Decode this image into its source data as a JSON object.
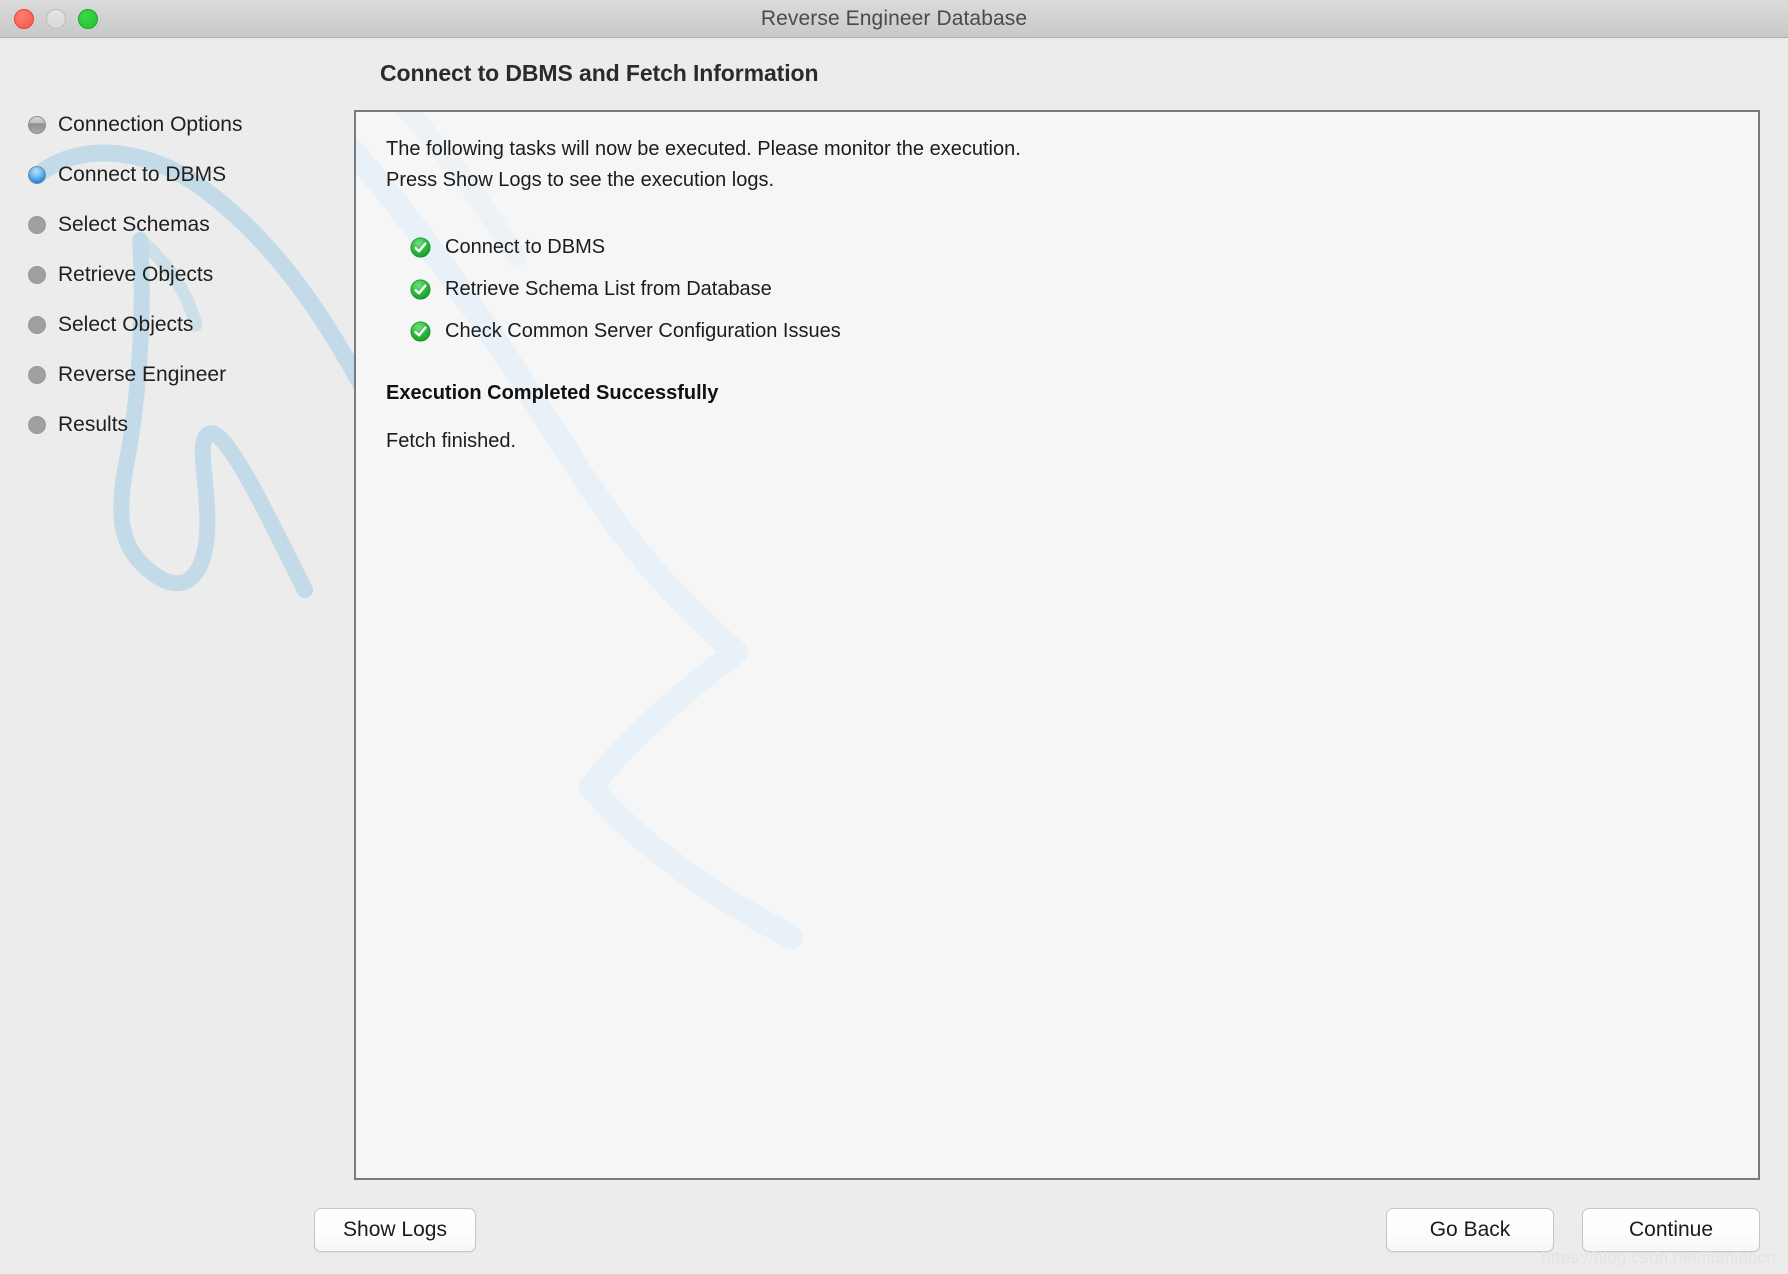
{
  "window": {
    "title": "Reverse Engineer Database",
    "traffic_lights": [
      "close",
      "minimize",
      "maximize"
    ]
  },
  "page": {
    "heading": "Connect to DBMS and Fetch Information"
  },
  "sidebar": {
    "items": [
      {
        "label": "Connection Options",
        "state": "done"
      },
      {
        "label": "Connect to DBMS",
        "state": "active"
      },
      {
        "label": "Select Schemas",
        "state": "todo"
      },
      {
        "label": "Retrieve Objects",
        "state": "todo"
      },
      {
        "label": "Select Objects",
        "state": "todo"
      },
      {
        "label": "Reverse Engineer",
        "state": "todo"
      },
      {
        "label": "Results",
        "state": "todo"
      }
    ]
  },
  "main": {
    "intro_line_1": "The following tasks will now be executed. Please monitor the execution.",
    "intro_line_2": "Press Show Logs to see the execution logs.",
    "tasks": [
      {
        "label": "Connect to DBMS",
        "status": "success",
        "icon": "check-circle-icon"
      },
      {
        "label": "Retrieve Schema List from Database",
        "status": "success",
        "icon": "check-circle-icon"
      },
      {
        "label": "Check Common Server Configuration Issues",
        "status": "success",
        "icon": "check-circle-icon"
      }
    ],
    "status_text": "Execution Completed Successfully",
    "detail_text": "Fetch finished."
  },
  "footer": {
    "show_logs_label": "Show Logs",
    "go_back_label": "Go Back",
    "continue_label": "Continue"
  },
  "watermark": "https://blog.csdn.net/liumiaocn",
  "colors": {
    "success_green": "#2db83d",
    "active_blue": "#1f7fd4",
    "window_bg": "#ececec",
    "panel_bg": "#f6f6f6",
    "panel_border": "#7a7a7a",
    "dolphin_blue": "#bcd8e8"
  }
}
